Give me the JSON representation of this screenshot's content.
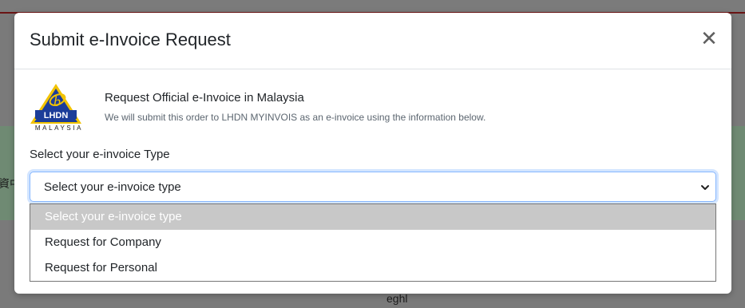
{
  "background": {
    "left_text": "資中",
    "bottom_text": "eghl"
  },
  "modal": {
    "title": "Submit e-Invoice Request",
    "close_icon": "close-icon"
  },
  "logo": {
    "label_top": "LHDN",
    "label_bottom": "MALAYSIA",
    "colors": {
      "yellow": "#f2c300",
      "blue": "#1c3d99"
    }
  },
  "info": {
    "title": "Request Official e-Invoice in Malaysia",
    "subtitle": "We will submit this order to LHDN MYINVOIS as an e-invoice using the information below."
  },
  "invoice_type": {
    "label": "Select your e-invoice Type",
    "selected_value": "Select your e-invoice type",
    "options": [
      "Select your e-invoice type",
      "Request for Company",
      "Request for Personal"
    ]
  },
  "colors": {
    "focus_border": "#86b7fe",
    "highlight_option": "#c8c8c8"
  }
}
